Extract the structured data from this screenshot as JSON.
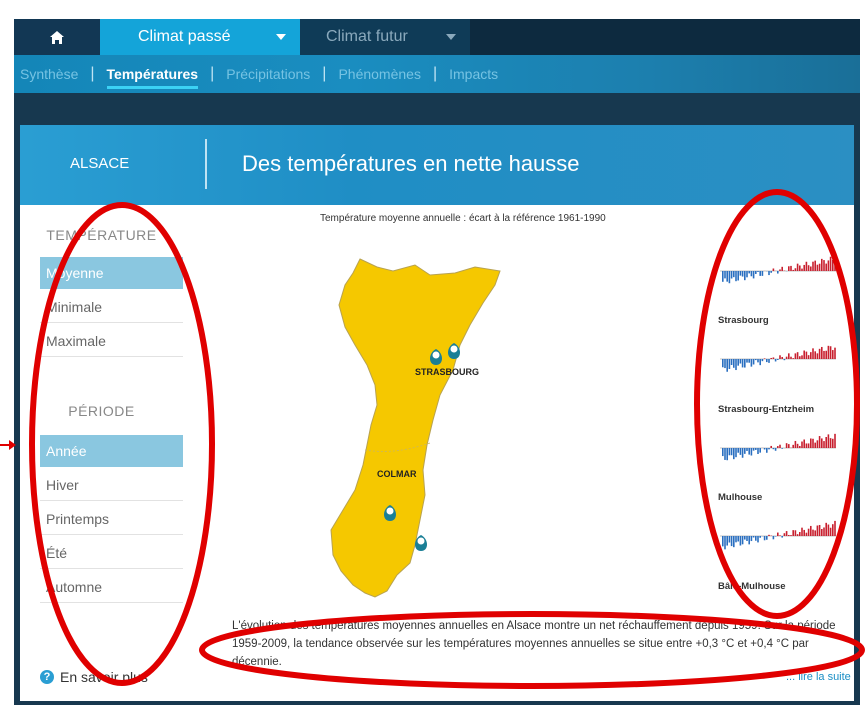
{
  "nav": {
    "home_icon": "home-icon",
    "tabs": [
      {
        "label": "Climat passé"
      },
      {
        "label": "Climat futur"
      }
    ],
    "subnav": [
      {
        "label": "Synthèse"
      },
      {
        "label": "Températures"
      },
      {
        "label": "Précipitations"
      },
      {
        "label": "Phénomènes"
      },
      {
        "label": "Impacts"
      }
    ]
  },
  "banner": {
    "region": "ALSACE",
    "headline": "Des températures en nette hausse"
  },
  "sidebar": {
    "temperature_heading": "TEMPÉRATURE",
    "temperature_options": [
      "Moyenne",
      "Minimale",
      "Maximale"
    ],
    "period_heading": "PÉRIODE",
    "period_options": [
      "Année",
      "Hiver",
      "Printemps",
      "Été",
      "Automne"
    ],
    "info_link": "En savoir plus"
  },
  "map": {
    "title": "Température moyenne annuelle : écart à la référence 1961-1990",
    "cities": [
      "STRASBOURG",
      "COLMAR"
    ]
  },
  "stations": [
    "Strasbourg",
    "Strasbourg-Entzheim",
    "Mulhouse",
    "Bâle-Mulhouse"
  ],
  "description": "L'évolution des températures moyennes annuelles en Alsace montre un net réchauffement depuis 1959. Sur la période 1959-2009, la tendance observée sur les températures moyennes annuelles se situe entre +0,3 °C et +0,4 °C par décennie.",
  "read_more": "... lire la suite",
  "colors": {
    "accent": "#14a4d9",
    "map_fill": "#f5c800",
    "annotation": "#e00000"
  }
}
